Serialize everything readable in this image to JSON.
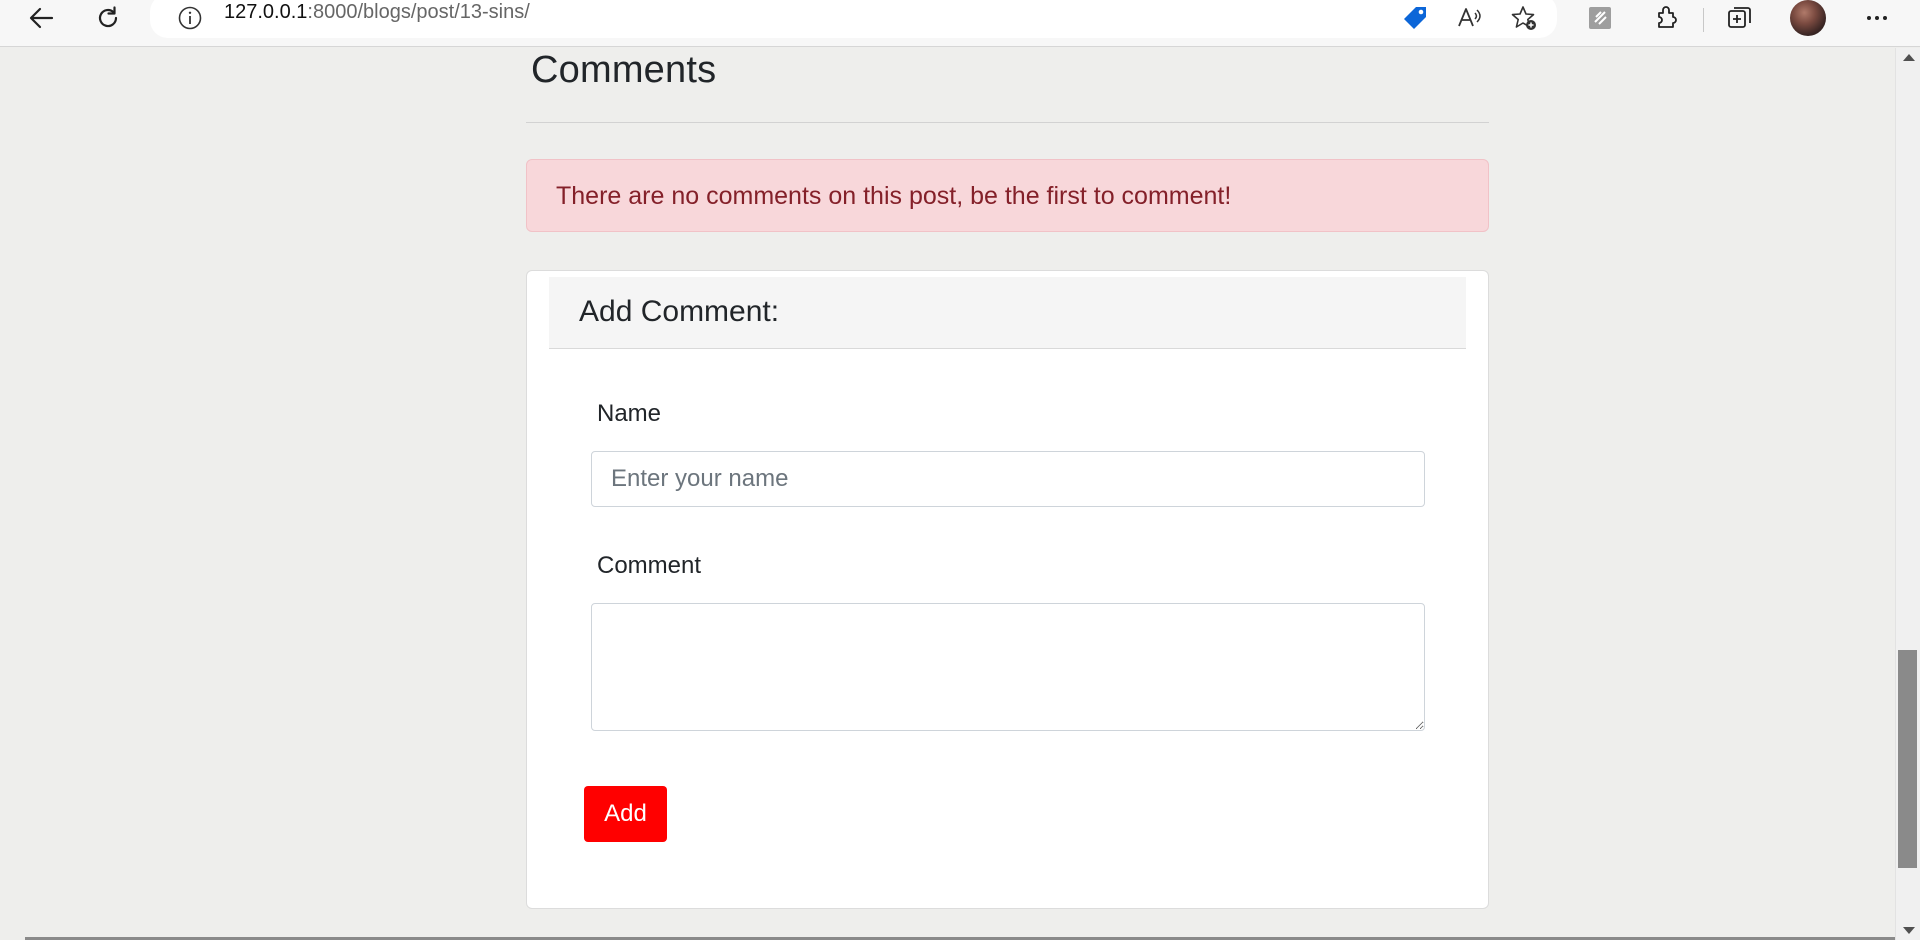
{
  "browser": {
    "url_host": "127.0.0.1",
    "url_path": ":8000/blogs/post/13-sins/",
    "icons": [
      "back-icon",
      "refresh-icon",
      "site-info-icon",
      "price-tag-icon",
      "read-aloud-icon",
      "add-favorite-icon",
      "collections-icon",
      "extensions-icon",
      "collections-add-icon",
      "profile-avatar",
      "more-icon"
    ],
    "accent_color": "#0c66d8"
  },
  "comments": {
    "title": "Comments",
    "empty_alert": "There are no comments on this post, be the first to comment!",
    "alert_bg": "#f8d7da",
    "alert_text_color": "#842029"
  },
  "form": {
    "header": "Add Comment:",
    "name_label": "Name",
    "name_placeholder": "Enter your name",
    "name_value": "",
    "comment_label": "Comment",
    "comment_value": "",
    "submit_label": "Add",
    "submit_color": "#ff0000"
  }
}
